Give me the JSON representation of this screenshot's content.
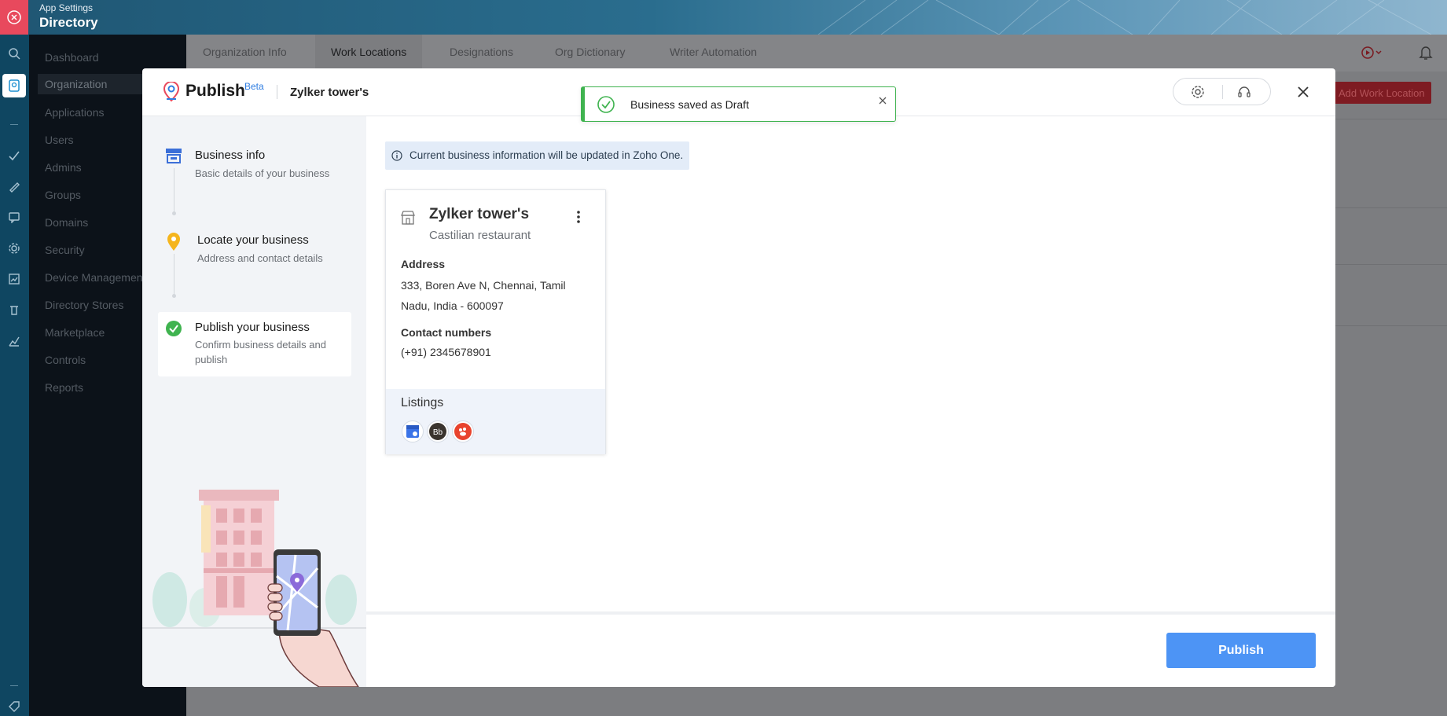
{
  "app": {
    "subtitle": "App Settings",
    "title": "Directory"
  },
  "sidebar": {
    "items": [
      {
        "label": "Dashboard"
      },
      {
        "label": "Organization"
      },
      {
        "label": "Applications"
      },
      {
        "label": "Users"
      },
      {
        "label": "Admins"
      },
      {
        "label": "Groups"
      },
      {
        "label": "Domains"
      },
      {
        "label": "Security"
      },
      {
        "label": "Device Managemen"
      },
      {
        "label": "Directory Stores"
      },
      {
        "label": "Marketplace"
      },
      {
        "label": "Controls"
      },
      {
        "label": "Reports"
      }
    ],
    "active": "Organization"
  },
  "tabs": [
    "Organization Info",
    "Work Locations",
    "Designations",
    "Org Dictionary",
    "Writer Automation"
  ],
  "active_tab": "Work Locations",
  "background_action": "Add Work Location",
  "modal": {
    "brand": "Publish",
    "badge": "Beta",
    "business_name": "Zylker tower's",
    "toast": "Business saved as Draft",
    "steps": [
      {
        "title": "Business info",
        "subtitle": "Basic details of your business"
      },
      {
        "title": "Locate your business",
        "subtitle": "Address and contact details"
      },
      {
        "title": "Publish your business",
        "subtitle": "Confirm business details and publish"
      }
    ],
    "info_banner": "Current business information will be updated in Zoho One.",
    "card": {
      "name": "Zylker tower's",
      "type": "Castilian restaurant",
      "address_label": "Address",
      "address": "333, Boren Ave N, Chennai, Tamil Nadu, India - 600097",
      "contact_label": "Contact numbers",
      "contact": "(+91) 2345678901",
      "listings_label": "Listings",
      "listings": [
        "google-business-icon",
        "bb-directory-icon",
        "yelp-like-icon"
      ]
    },
    "publish_button": "Publish"
  },
  "colors": {
    "accent": "#4d94f5",
    "success": "#3fb34f",
    "header": "#1f5673",
    "danger": "#e8495d"
  }
}
